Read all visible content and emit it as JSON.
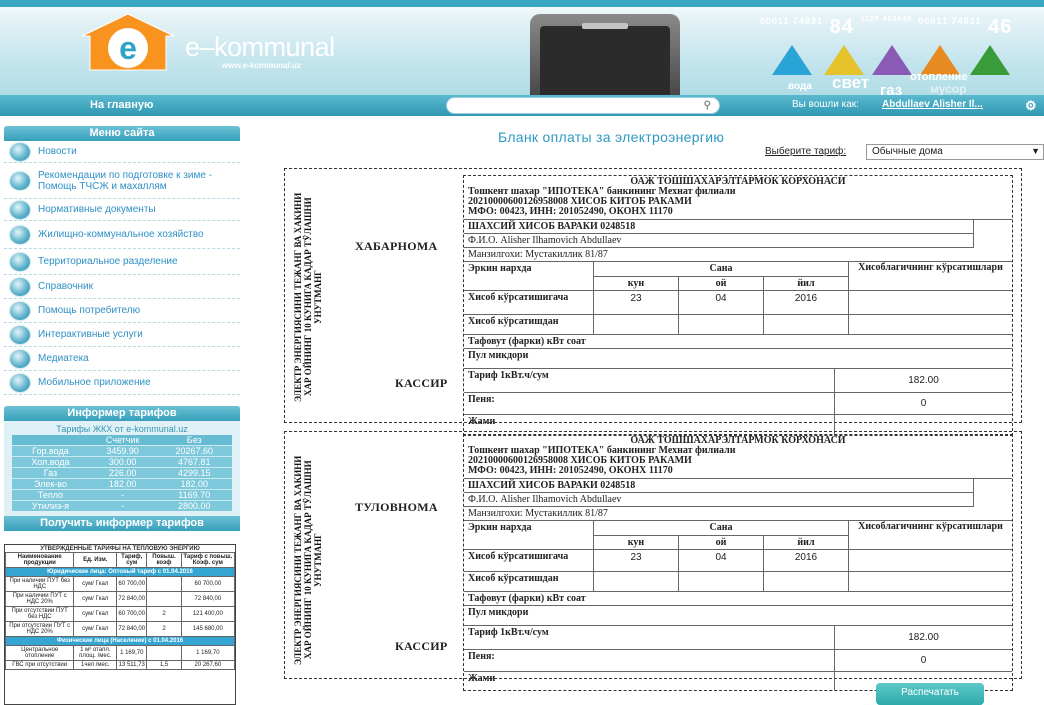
{
  "header": {
    "logo_letter": "e",
    "logo_text": "e–kommunal",
    "logo_sub": "www.e-kommunal.uz",
    "meter_left": "00011 74831",
    "meter_mid": "84",
    "meter_small": "1125 458649",
    "meter_right": "00011 74831",
    "meter_end": "46",
    "utilities": [
      "вода",
      "свет",
      "газ",
      "отопление",
      "мусор"
    ]
  },
  "nav": {
    "home": "На главную",
    "search_placeholder": "",
    "login_label": "Вы вошли как:",
    "user": "Abdullaev Alisher Il..."
  },
  "sidebar": {
    "menu_title": "Меню сайта",
    "items": [
      {
        "label": "Новости"
      },
      {
        "label": "Рекомендации по подготовке к зиме - Помощь ТЧСЖ и махаллям"
      },
      {
        "label": "Нормативные документы"
      },
      {
        "label": "Жилищно-коммунальное хозяйство"
      },
      {
        "label": "Территориальное разделение"
      },
      {
        "label": "Справочник"
      },
      {
        "label": "Помощь потребителю"
      },
      {
        "label": "Интерактивные услуги"
      },
      {
        "label": "Медиатека"
      },
      {
        "label": "Мобильное приложение"
      }
    ],
    "informer_title": "Информер тарифов",
    "informer_sub": "Тарифы ЖКХ от e-kommunal.uz",
    "informer_headers": [
      "",
      "Счетчик",
      "Без"
    ],
    "informer_rows": [
      [
        "Гор.вода",
        "3459.90",
        "20267.60"
      ],
      [
        "Хол.вода",
        "300.00",
        "4767.81"
      ],
      [
        "Газ",
        "226.00",
        "4299.15"
      ],
      [
        "Элек-во",
        "182.00",
        "182.00"
      ],
      [
        "Тепло",
        "-",
        "1169.70"
      ],
      [
        "Утилиз-я",
        "-",
        "2800.00"
      ]
    ],
    "informer_button": "Получить информер тарифов"
  },
  "heat_table": {
    "title": "УТВЕРЖДЕННЫЕ ТАРИФЫ НА ТЕПЛОВУЮ ЭНЕРГИЮ",
    "headers": [
      "Наименование продукции",
      "Ед. Изм.",
      "Тариф, сум",
      "Повыш. коэф",
      "Тариф с повыш. Коэф. сум"
    ],
    "band1": "Юридические лица: Оптовый тариф с 01.04.2016",
    "rows1": [
      [
        "При наличии ПУТ без НДС",
        "сум/ Гкал",
        "60 700,00",
        "",
        "60 700,00"
      ],
      [
        "При наличии ПУТ с НДС 20%",
        "сум/ Гкал",
        "72 840,00",
        "",
        "72 840,00"
      ],
      [
        "При отсутствии ПУТ без НДС",
        "сум/ Гкал",
        "60 700,00",
        "2",
        "121 400,00"
      ],
      [
        "При отсутствии ПУТ с НДС 20%",
        "сум/ Гкал",
        "72 840,00",
        "2",
        "145 680,00"
      ]
    ],
    "band2": "Физические лица (Население) с 01.04.2016",
    "rows2": [
      [
        "Центральное отопление",
        "1 м² отапл. площ. /мес.",
        "1 169,70",
        "",
        "1 169,70"
      ],
      [
        "ГВС при отсутствии",
        "1чел /мес.",
        "13 511,73",
        "1,5",
        "20 267,60"
      ]
    ]
  },
  "main": {
    "title": "Бланк оплаты за электроэнергию",
    "tariff_label": "Выберите тариф:",
    "tariff_value": "Обычные дома",
    "print_button": "Распечатать"
  },
  "forms": [
    {
      "side_line1": "ЭЛЕКТР ЭНЕРГИЯСИНИ ТЕЖАНГ ВА ХАКИНИ",
      "side_line2": "ХАР ОЙНИНГ 10 КУНИГА КАДАР ТЎЛАШНИ УНУТМАНГ",
      "label": "ХАБАРНОМА",
      "cashier": "КАССИР",
      "org": "ОАЖ ТОШШАХАРЭЛТАРМОК КОРХОНАСИ",
      "bank": "Тошкент шахар \"ИПОТЕКА\" банкининг Мехнат филиали",
      "account": "20210000600126958008 ХИСОБ КИТОБ РАКАМИ",
      "mfo": "МФО: 00423, ИНН: 201052490, ОКОНХ 11170",
      "personal": "ШАХСИЙ ХИСОБ ВАРАКИ 0248518",
      "fio": "Ф.И.О. Alisher Ilhamovich Abdullaev",
      "address": "Манзилгохи: Мустакиллик 81/87",
      "col_rate": "Эркин нархда",
      "col_date": "Сана",
      "col_meter": "Хисоблагичнинг кўрсатишлари",
      "sub_day": "кун",
      "sub_month": "ой",
      "sub_year": "йил",
      "row_to": "Хисоб кўрсатишигача",
      "row_from": "Хисоб кўрсатишдан",
      "day": "23",
      "month": "04",
      "year": "2016",
      "diff": "Тафовут (фарки) кВт соат",
      "amount": "Пул микдори",
      "tariff_lbl": "Тариф 1кВт.ч/сум",
      "tariff_val": "182.00",
      "penalty_lbl": "Пеня:",
      "penalty_val": "0",
      "total_lbl": "Жами"
    },
    {
      "side_line1": "ЭЛЕКТР ЭНЕРГИЯСИНИ ТЕЖАНГ ВА ХАКИНИ",
      "side_line2": "ХАР ОЙНИНГ 10 КУНИГА КАДАР ТЎЛАШНИ УНУТМАНГ",
      "label": "ТУЛОВНОМА",
      "cashier": "КАССИР",
      "org": "ОАЖ ТОШШАХАРЭЛТАРМОК КОРХОНАСИ",
      "bank": "Тошкент шахар \"ИПОТЕКА\" банкининг Мехнат филиали",
      "account": "20210000600126958008 ХИСОБ КИТОБ РАКАМИ",
      "mfo": "МФО: 00423, ИНН: 201052490, ОКОНХ 11170",
      "personal": "ШАХСИЙ ХИСОБ ВАРАКИ 0248518",
      "fio": "Ф.И.О. Alisher Ilhamovich Abdullaev",
      "address": "Манзилгохи: Мустакиллик 81/87",
      "col_rate": "Эркин нархда",
      "col_date": "Сана",
      "col_meter": "Хисоблагичнинг кўрсатишлари",
      "sub_day": "кун",
      "sub_month": "ой",
      "sub_year": "йил",
      "row_to": "Хисоб кўрсатишигача",
      "row_from": "Хисоб кўрсатишдан",
      "day": "23",
      "month": "04",
      "year": "2016",
      "diff": "Тафовут (фарки) кВт соат",
      "amount": "Пул микдори",
      "tariff_lbl": "Тариф 1кВт.ч/сум",
      "tariff_val": "182.00",
      "penalty_lbl": "Пеня:",
      "penalty_val": "0",
      "total_lbl": "Жами"
    }
  ]
}
